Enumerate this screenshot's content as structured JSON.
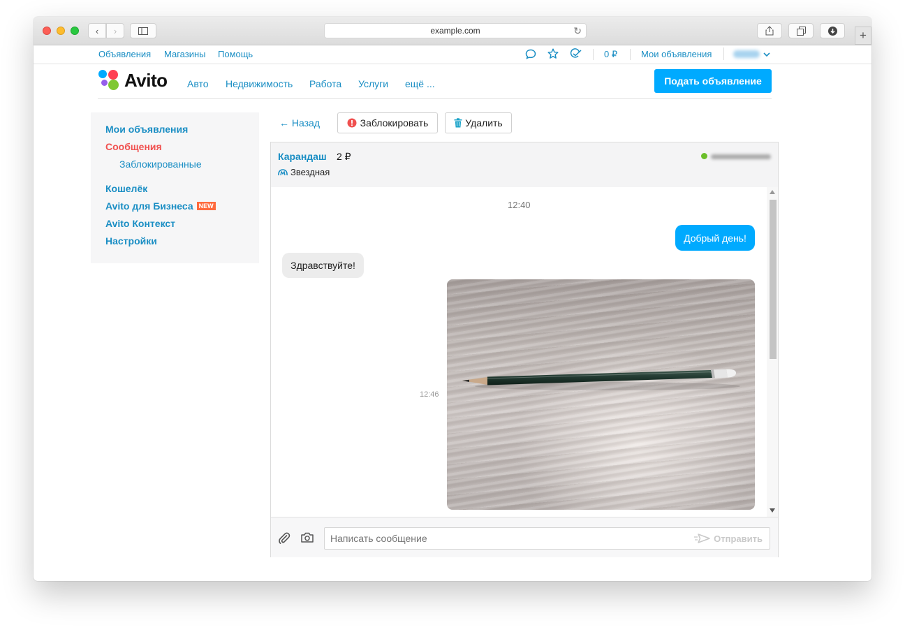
{
  "browser": {
    "url": "example.com"
  },
  "topnav": {
    "links": [
      "Объявления",
      "Магазины",
      "Помощь"
    ],
    "balance": "0 ₽",
    "my_ads": "Мои объявления"
  },
  "header": {
    "logo": "Avito",
    "nav": [
      "Авто",
      "Недвижимость",
      "Работа",
      "Услуги",
      "ещё ..."
    ],
    "post_button": "Подать объявление"
  },
  "sidebar": {
    "items": [
      {
        "label": "Мои объявления"
      },
      {
        "label": "Сообщения"
      },
      {
        "label": "Заблокированные"
      },
      {
        "label": "Кошелёк"
      },
      {
        "label": "Avito для Бизнеса",
        "badge": "NEW"
      },
      {
        "label": "Avito Контекст"
      },
      {
        "label": "Настройки"
      }
    ]
  },
  "toolbar": {
    "back": "← Назад",
    "block": "Заблокировать",
    "delete": "Удалить"
  },
  "chat": {
    "item_title": "Карандаш",
    "price": "2 ₽",
    "metro": "Звездная",
    "messages": [
      {
        "type": "time",
        "text": "12:40"
      },
      {
        "type": "out",
        "text": "Добрый день!"
      },
      {
        "type": "in",
        "text": "Здравствуйте!"
      },
      {
        "type": "photo",
        "time": "12:46"
      }
    ],
    "input_placeholder": "Написать сообщение",
    "send_label": "Отправить"
  },
  "colors": {
    "brand_blue": "#00aaff",
    "link": "#1a8ec4",
    "active": "#f0504f",
    "online": "#6bbf2a"
  }
}
